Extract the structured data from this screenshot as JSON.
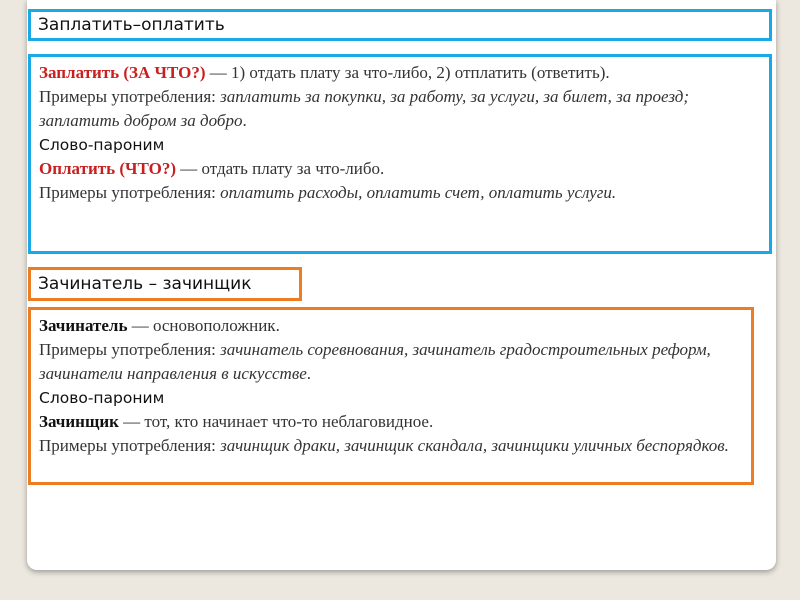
{
  "block1": {
    "title": "Заплатить–оплатить",
    "term1": "Заплатить (ЗА ЧТО?)",
    "def1": " — 1) отдать плату за что-либо, 2) отплатить (ответить).",
    "ex_label1": "Примеры употребления:  ",
    "ex1": "заплатить за покупки, за работу, за услуги, за билет, за проезд; заплатить добром за добро",
    "paronym_label": "Слово-пароним",
    "term2": "Оплатить (ЧТО?)",
    "def2": " — отдать плату за что-либо.",
    "ex_label2": "Примеры употребления: ",
    "ex2": "оплатить расходы, оплатить счет, оплатить услуги."
  },
  "block2": {
    "title": "Зачинатель – зачинщик",
    "term1": "Зачинатель",
    "def1": " — основоположник.",
    "ex_label1": "Примеры употребления: ",
    "ex1": "зачинатель соревнования, зачинатель градостроительных реформ, зачинатели направления в искусстве",
    "paronym_label": "Слово-пароним",
    "term2": "Зачинщик",
    "def2": " — тот, кто начинает что-то неблаговидное.",
    "ex_label2": "Примеры употребления: ",
    "ex2": "зачинщик драки, зачинщик скандала, зачинщики уличных беспорядков."
  },
  "colors": {
    "blue_border": "#19a9e6",
    "orange_border": "#ec7d23",
    "term_red": "#c81f1f",
    "background": "#ece8e0"
  }
}
